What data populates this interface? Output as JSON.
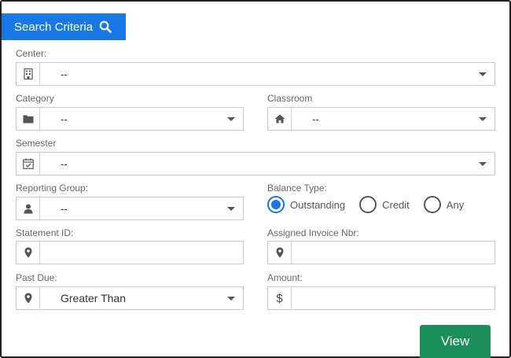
{
  "header": {
    "title": "Search Criteria",
    "icon": "search-icon"
  },
  "fields": {
    "center": {
      "label": "Center:",
      "value": "--",
      "icon": "building-icon"
    },
    "category": {
      "label": "Category",
      "value": "--",
      "icon": "folder-icon"
    },
    "classroom": {
      "label": "Classroom",
      "value": "--",
      "icon": "home-icon"
    },
    "semester": {
      "label": "Semester",
      "value": "--",
      "icon": "calendar-check-icon"
    },
    "reporting_group": {
      "label": "Reporting Group:",
      "value": "--",
      "icon": "user-icon"
    },
    "balance_type": {
      "label": "Balance Type:",
      "options": [
        "Outstanding",
        "Credit",
        "Any"
      ],
      "selected": "Outstanding"
    },
    "statement_id": {
      "label": "Statement ID:",
      "value": "",
      "icon": "map-marker-icon"
    },
    "assigned_invoice": {
      "label": "Assigned Invoice Nbr:",
      "value": "",
      "icon": "map-marker-icon"
    },
    "past_due": {
      "label": "Past Due:",
      "value": "Greater Than",
      "icon": "map-marker-icon"
    },
    "amount": {
      "label": "Amount:",
      "value": "",
      "icon": "dollar-icon",
      "icon_text": "$"
    }
  },
  "actions": {
    "view_label": "View"
  },
  "colors": {
    "tab": "#1878e6",
    "view_button": "#1a8f5a",
    "radio_selected": "#1a73e8"
  }
}
